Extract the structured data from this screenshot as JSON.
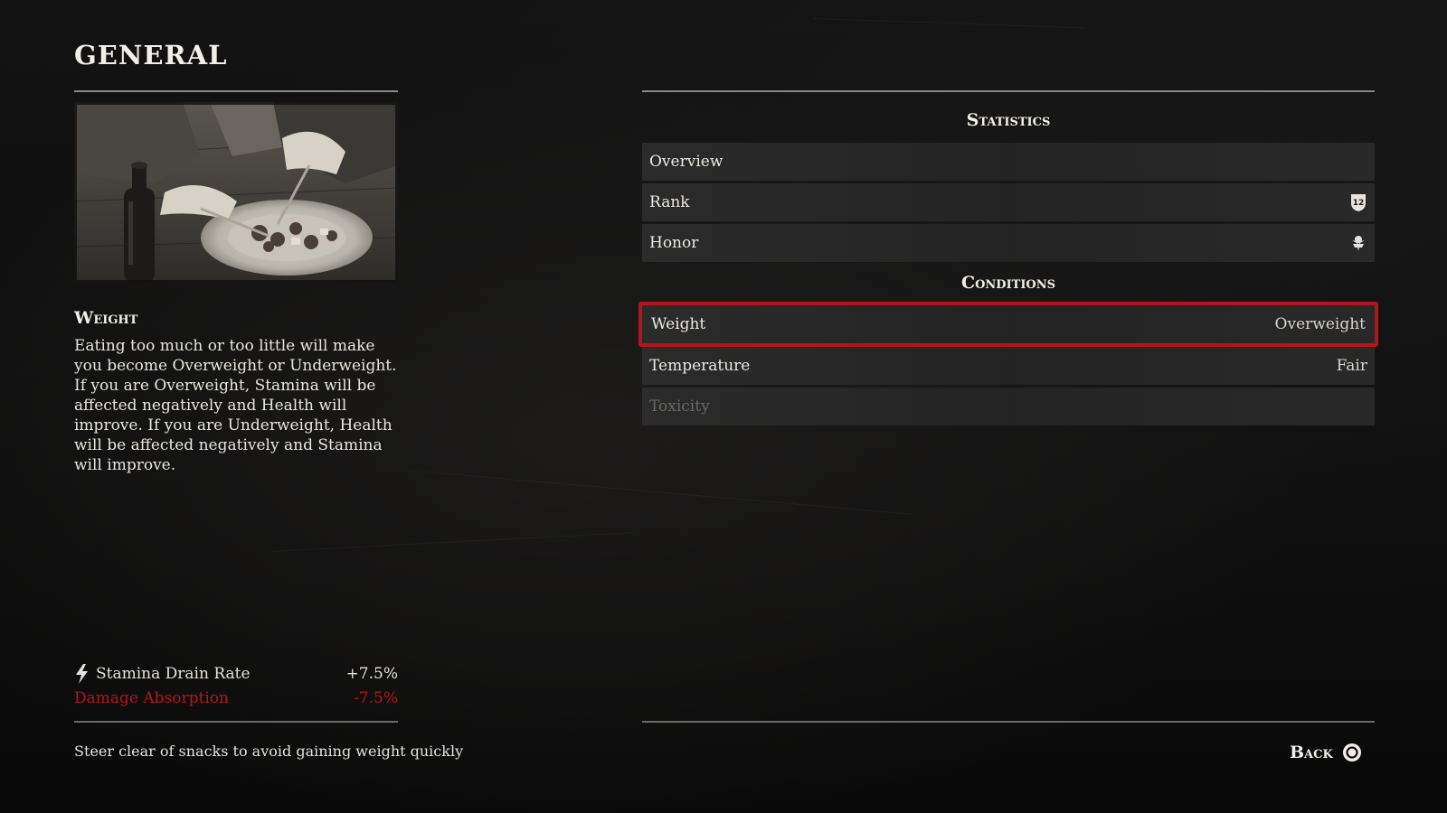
{
  "page": {
    "title": "GENERAL"
  },
  "detail": {
    "title": "Weight",
    "description": "Eating too much or too little will make you become Overweight or Underweight. If you are Overweight, Stamina will be affected negatively and Health will improve. If you are Underweight, Health will be affected negatively and Stamina will improve.",
    "effects": [
      {
        "label": "Stamina Drain Rate",
        "value": "+7.5%",
        "icon": "lightning-bolt-icon",
        "color": "#e6e2dc"
      },
      {
        "label": "Damage Absorption",
        "value": "-7.5%",
        "color": "#b4161a"
      }
    ],
    "hint": "Steer clear of snacks to avoid gaining weight quickly"
  },
  "statistics": {
    "heading": "Statistics",
    "rows": [
      {
        "label": "Overview"
      },
      {
        "label": "Rank",
        "icon": "rank-shield-icon",
        "icon_text": "12"
      },
      {
        "label": "Honor",
        "icon": "honor-icon"
      }
    ]
  },
  "conditions": {
    "heading": "Conditions",
    "rows": [
      {
        "label": "Weight",
        "value": "Overweight",
        "selected": true
      },
      {
        "label": "Temperature",
        "value": "Fair"
      },
      {
        "label": "Toxicity",
        "disabled": true
      }
    ]
  },
  "footer": {
    "back_label": "Back",
    "back_icon": "circle-button-icon"
  },
  "colors": {
    "accent_red": "#b5141a",
    "background": "#0b0b0b",
    "row_bg": "#2c2c2c"
  }
}
